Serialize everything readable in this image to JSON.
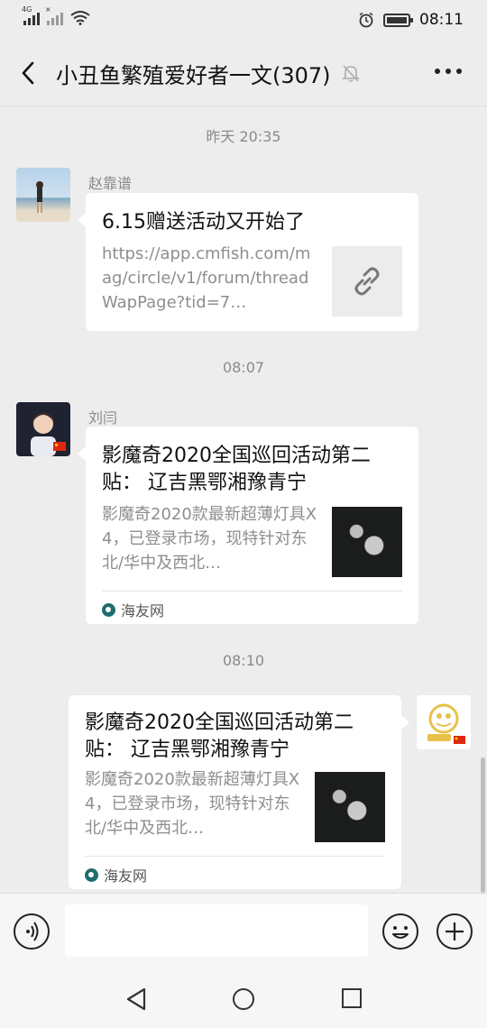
{
  "status_bar": {
    "network_1": "4G",
    "network_2": "×",
    "time": "08:11"
  },
  "header": {
    "title": "小丑鱼繁殖爱好者一文(307)"
  },
  "messages": [
    {
      "timestamp": "昨天 20:35",
      "sender": "赵靠谱",
      "link_title": "6.15赠送活动又开始了",
      "link_desc": "https://app.cmfish.com/mag/circle/v1/forum/threadWapPage?tid=7…",
      "thumb_icon": "link-icon"
    },
    {
      "timestamp": "08:07",
      "sender": "刘闫",
      "link_title": "影魔奇2020全国巡回活动第二贴： 辽吉黑鄂湘豫青宁",
      "link_desc": "影魔奇2020款最新超薄灯具X4，已登录市场，现特针对东北/华中及西北…",
      "source": "海友网"
    },
    {
      "timestamp": "08:10",
      "link_title": "影魔奇2020全国巡回活动第二贴： 辽吉黑鄂湘豫青宁",
      "link_desc": "影魔奇2020款最新超薄灯具X4，已登录市场，现特针对东北/华中及西北…",
      "source": "海友网"
    }
  ],
  "input_bar": {
    "placeholder": ""
  },
  "colors": {
    "background": "#ededed",
    "bubble": "#ffffff",
    "muted_text": "#8a8a8a"
  }
}
